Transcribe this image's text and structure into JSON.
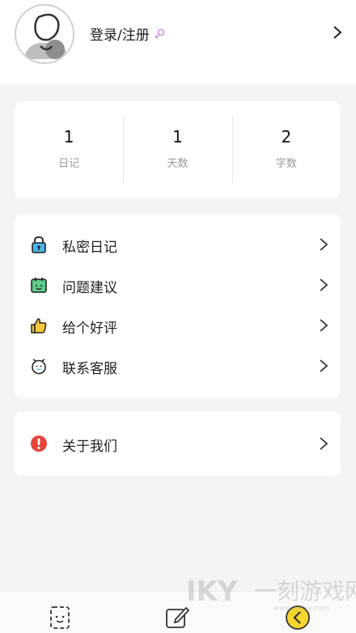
{
  "profile": {
    "login_label": "登录/注册"
  },
  "stats": [
    {
      "value": "1",
      "label": "日记"
    },
    {
      "value": "1",
      "label": "天数"
    },
    {
      "value": "2",
      "label": "字数"
    }
  ],
  "menu": [
    {
      "label": "私密日记",
      "icon": "lock-icon"
    },
    {
      "label": "问题建议",
      "icon": "calendar-face-icon"
    },
    {
      "label": "给个好评",
      "icon": "thumbs-up-icon"
    },
    {
      "label": "联系客服",
      "icon": "alarm-clock-icon"
    }
  ],
  "about": {
    "label": "关于我们",
    "icon": "exclamation-icon"
  },
  "tabs": [
    "diary-tab-icon",
    "edit-tab-icon",
    "mine-tab-icon"
  ],
  "watermark": {
    "text": "一刻游戏网",
    "url": "www.iykxy.com"
  },
  "colors": {
    "background": "#f4f4f5",
    "card": "#ffffff",
    "lock": "#4ab3e8",
    "calendar": "#5cc98a",
    "thumb": "#f5c93a",
    "alert": "#e5453a",
    "active_tab": "#f7d62e"
  }
}
